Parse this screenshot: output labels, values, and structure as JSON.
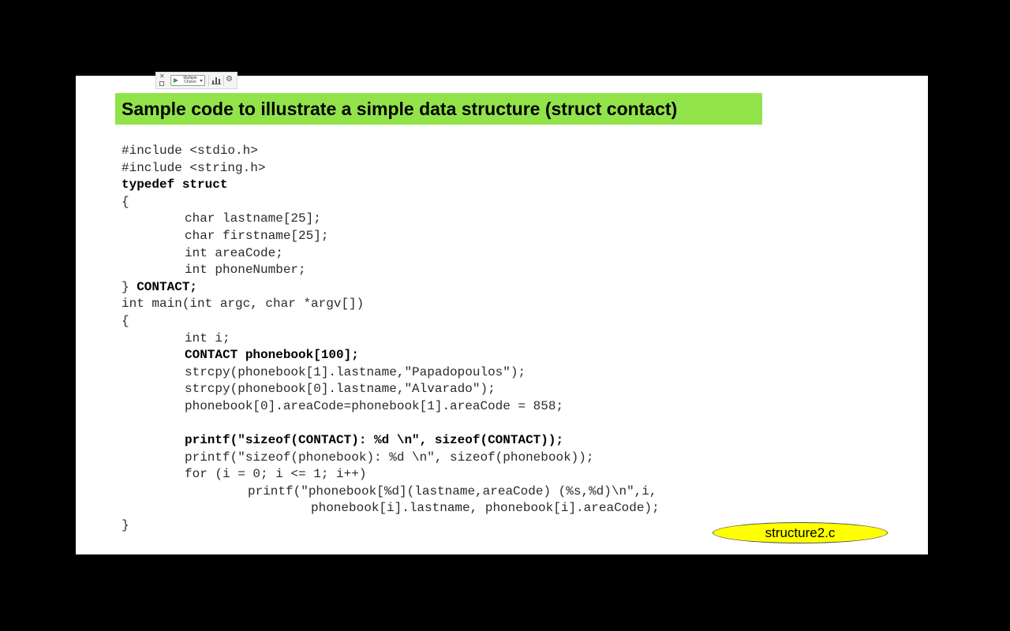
{
  "toolbar": {
    "poll_label": "Multiple Choice",
    "close_icon": "close-icon",
    "pin_icon": "pin-icon",
    "play_icon": "play-icon",
    "chart_icon": "bar-chart-icon",
    "settings_icon": "gear-icon"
  },
  "slide": {
    "title": "Sample code to illustrate a simple data structure (struct contact)",
    "title_bg": "#92e34a",
    "filename": "structure2.c",
    "filename_bg": "#ffff00",
    "code_lines": [
      {
        "indent": 0,
        "text": "#include <stdio.h>",
        "bold": false
      },
      {
        "indent": 0,
        "text": "#include <string.h>",
        "bold": false
      },
      {
        "indent": 0,
        "text": "typedef struct",
        "bold": true
      },
      {
        "indent": 0,
        "text": "{",
        "bold": false
      },
      {
        "indent": 1,
        "text": "char lastname[25];",
        "bold": false
      },
      {
        "indent": 1,
        "text": "char firstname[25];",
        "bold": false
      },
      {
        "indent": 1,
        "text": "int areaCode;",
        "bold": false
      },
      {
        "indent": 1,
        "text": "int phoneNumber;",
        "bold": false
      },
      {
        "indent": 0,
        "text": "} ",
        "bold_tail": "CONTACT;"
      },
      {
        "indent": 0,
        "text": "int main(int argc, char *argv[])",
        "bold": false
      },
      {
        "indent": 0,
        "text": "{",
        "bold": false
      },
      {
        "indent": 1,
        "text": "int i;",
        "bold": false
      },
      {
        "indent": 1,
        "text": "CONTACT phonebook[100];",
        "bold": true
      },
      {
        "indent": 1,
        "text": "strcpy(phonebook[1].lastname,\"Papadopoulos\");",
        "bold": false
      },
      {
        "indent": 1,
        "text": "strcpy(phonebook[0].lastname,\"Alvarado\");",
        "bold": false
      },
      {
        "indent": 1,
        "text": "phonebook[0].areaCode=phonebook[1].areaCode = 858;",
        "bold": false
      },
      {
        "indent": 0,
        "text": "",
        "bold": false
      },
      {
        "indent": 1,
        "text": "printf(\"sizeof(CONTACT): %d \\n\", sizeof(CONTACT));",
        "bold": true
      },
      {
        "indent": 1,
        "text": "printf(\"sizeof(phonebook): %d \\n\", sizeof(phonebook));",
        "bold": false
      },
      {
        "indent": 1,
        "text": "for (i = 0; i <= 1; i++)",
        "bold": false
      },
      {
        "indent": 2,
        "text": "printf(\"phonebook[%d](lastname,areaCode) (%s,%d)\\n\",i,",
        "bold": false
      },
      {
        "indent": 3,
        "text": "phonebook[i].lastname, phonebook[i].areaCode);",
        "bold": false
      },
      {
        "indent": 0,
        "text": "}",
        "bold": false
      }
    ]
  }
}
